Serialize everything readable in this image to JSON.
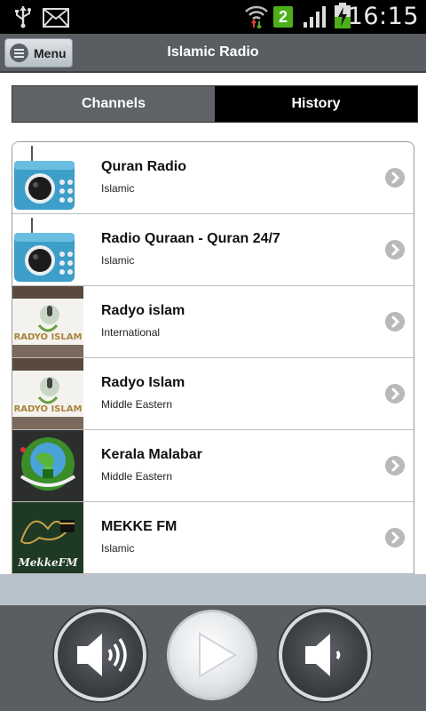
{
  "status_bar": {
    "time": "16:15",
    "notification_count": "2",
    "icons": [
      "usb-icon",
      "mail-icon",
      "wifi-icon",
      "notification-badge",
      "signal-icon",
      "battery-charging-icon"
    ]
  },
  "action_bar": {
    "menu_label": "Menu",
    "title": "Islamic Radio"
  },
  "tabs": [
    {
      "label": "Channels",
      "selected": false
    },
    {
      "label": "History",
      "selected": true
    }
  ],
  "channels": [
    {
      "name": "Quran Radio",
      "category": "Islamic",
      "thumb": "radio-icon"
    },
    {
      "name": "Radio Quraan - Quran 24/7",
      "category": "Islamic",
      "thumb": "radio-icon"
    },
    {
      "name": "Radyo islam",
      "category": "International",
      "thumb": "radyo-islam-logo"
    },
    {
      "name": "Radyo Islam",
      "category": "Middle Eastern",
      "thumb": "radyo-islam-logo"
    },
    {
      "name": "Kerala Malabar",
      "category": "Middle Eastern",
      "thumb": "kerala-malabar-logo"
    },
    {
      "name": "MEKKE FM",
      "category": "Islamic",
      "thumb": "mekke-fm-logo"
    }
  ],
  "logos": {
    "radyo_islam": "RADYO ISLAM",
    "mekke_fm": "MekkeFM"
  },
  "player": {
    "buttons": [
      "volume-up-icon",
      "play-icon",
      "volume-down-icon"
    ]
  },
  "colors": {
    "action_bar": "#5a5e63",
    "tab_channels": "#5f6368",
    "tab_history": "#000000",
    "player_bg": "#5a5e63"
  }
}
